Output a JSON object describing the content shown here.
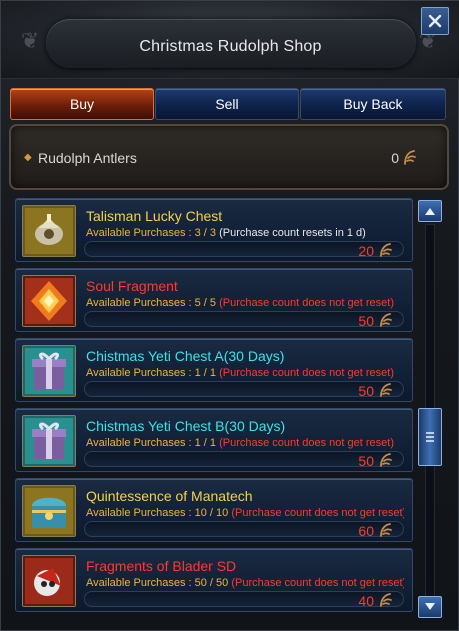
{
  "window": {
    "title": "Christmas Rudolph Shop",
    "close_icon": "close-icon"
  },
  "tabs": [
    {
      "label": "Buy",
      "active": true
    },
    {
      "label": "Sell",
      "active": false
    },
    {
      "label": "Buy Back",
      "active": false
    }
  ],
  "currency": {
    "name": "Rudolph Antlers",
    "count": "0",
    "icon": "antler-icon"
  },
  "items": [
    {
      "name": "Talisman Lucky Chest",
      "name_color": "gold",
      "purchases_label": "Available Purchases : 3 / 3",
      "purchases_note": " (Purchase count resets in 1 d)",
      "note_color": "white",
      "price": "20",
      "icon": "talisman-chest-icon"
    },
    {
      "name": "Soul Fragment",
      "name_color": "red",
      "purchases_label": "Available Purchases : 5 / 5",
      "purchases_note": " (Purchase count does not get reset)",
      "note_color": "red",
      "price": "50",
      "icon": "soul-fragment-icon"
    },
    {
      "name": "Chistmas Yeti Chest A(30 Days)",
      "name_color": "cyan",
      "purchases_label": "Available Purchases : 1 / 1",
      "purchases_note": " (Purchase count does not get reset)",
      "note_color": "red",
      "price": "50",
      "icon": "gift-box-icon"
    },
    {
      "name": "Chistmas Yeti Chest B(30 Days)",
      "name_color": "cyan",
      "purchases_label": "Available Purchases : 1 / 1",
      "purchases_note": " (Purchase count does not get reset)",
      "note_color": "red",
      "price": "50",
      "icon": "gift-box-icon"
    },
    {
      "name": "Quintessence of Manatech",
      "name_color": "gold",
      "purchases_label": "Available Purchases : 10 / 10",
      "purchases_note": " (Purchase count does not get reset)",
      "note_color": "red",
      "price": "60",
      "icon": "treasure-chest-icon"
    },
    {
      "name": "Fragments of Blader SD",
      "name_color": "red",
      "purchases_label": "Available Purchases : 50 / 50",
      "purchases_note": " (Purchase count does not get reset)",
      "note_color": "red",
      "price": "40",
      "icon": "blader-fragment-icon"
    }
  ],
  "colors": {
    "gold": "#f2d34a",
    "red": "#ff3a2a",
    "cyan": "#39e3ea",
    "tab_active": "#b5431a",
    "tab_inactive": "#1d3a6e"
  },
  "scrollbar": {
    "up_icon": "arrow-up-icon",
    "down_icon": "arrow-down-icon",
    "thumb_icon": "grip-lines-icon"
  }
}
